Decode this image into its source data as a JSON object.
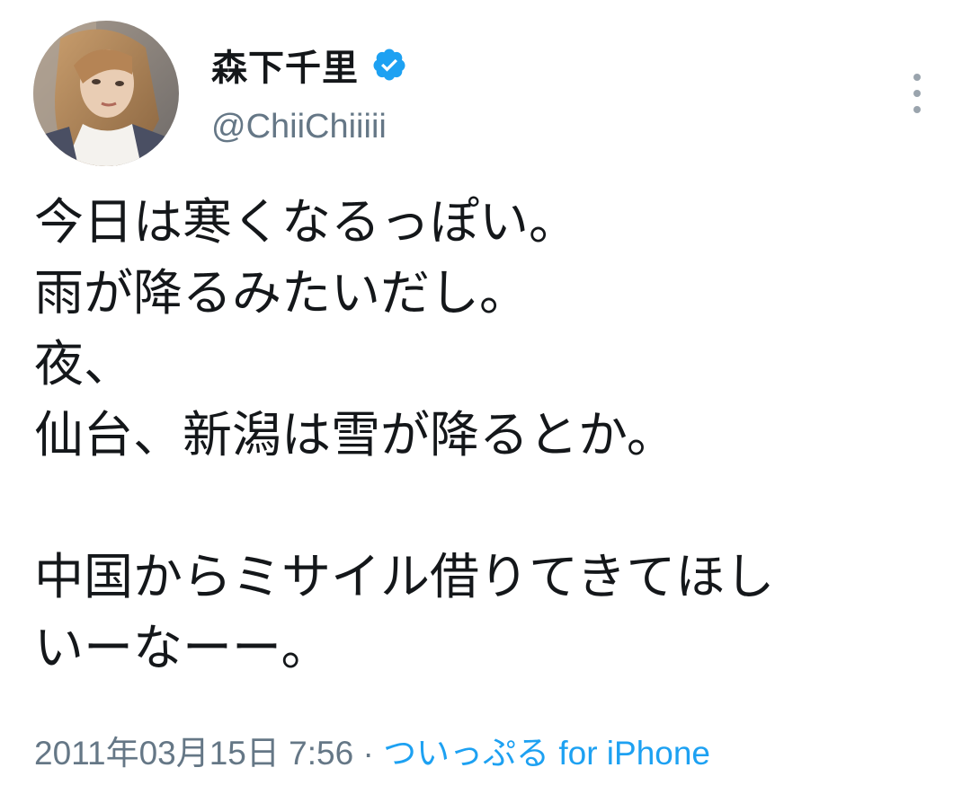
{
  "user": {
    "display_name": "森下千里",
    "handle": "@ChiiChiiiii",
    "verified": true
  },
  "tweet": {
    "lines": [
      "今日は寒くなるっぽい。",
      "雨が降るみたいだし。",
      "夜、",
      "仙台、新潟は雪が降るとか。",
      "",
      "中国からミサイル借りてきてほし",
      "いーなーー。"
    ]
  },
  "meta": {
    "timestamp": "2011年03月15日 7:56",
    "separator": "·",
    "source": "ついっぷる for iPhone"
  },
  "colors": {
    "verified": "#1da1f2",
    "link": "#1da1f2",
    "secondary_text": "#657786"
  },
  "icons": {
    "verified": "verified-badge-icon",
    "more": "more-vertical-icon"
  }
}
